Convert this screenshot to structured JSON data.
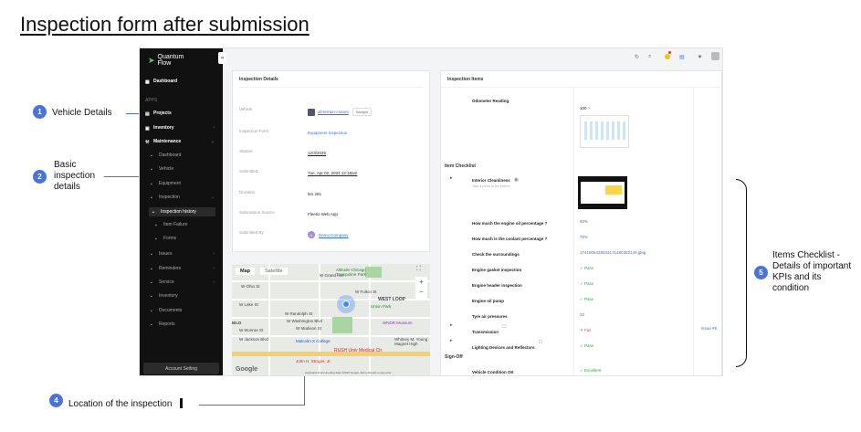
{
  "page_title": "Inspection form after submission",
  "callouts": [
    {
      "num": "1",
      "text": "Vehicle Details"
    },
    {
      "num": "2",
      "text": "Basic inspection details"
    },
    {
      "num": "4",
      "text": "Location of the inspection"
    },
    {
      "num": "5",
      "text": "Items Checklist - Details of important KPIs and its condition"
    }
  ],
  "sidebar": {
    "logo_line1": "Quantum",
    "logo_line2": "Flow",
    "dashboard": "Dashboard",
    "apps_heading": "APPS",
    "projects": "Projects",
    "inventory": "Inventory",
    "maintenance": "Maintenance",
    "sub_dashboard": "Dashboard",
    "vehicle": "Vehicle",
    "equipment": "Equipment",
    "inspection": "Inspection",
    "inspection_history": "Inspection history",
    "item_failure": "Item Failure",
    "forms": "Forms",
    "issues": "Issues",
    "reminders": "Reminders",
    "service": "Service",
    "inventory2": "Inventory",
    "documents": "Documents",
    "reports": "Reports",
    "account_setting": "Account Setting"
  },
  "details": {
    "title": "Inspection Details",
    "vehicle_label": "Vehicle",
    "vehicle_value": "all-terrain-cranes",
    "vehicle_chip": "Sample",
    "form_label": "Inspection Form",
    "form_value": "Equipment Inspection",
    "started_label": "Started",
    "started_value": "12/3/2025",
    "submitted_label": "Submitted",
    "submitted_value": "Tue, Apr 02, 2024 12:18am",
    "duration_label": "Duration",
    "duration_value": "5m 28s",
    "source_label": "Submission Source",
    "source_value": "Fleetio Web App",
    "by_label": "Submitted By",
    "by_avatar": "D",
    "by_value": "Demo Company"
  },
  "map": {
    "tab_map": "Map",
    "tab_satellite": "Satellite",
    "labels": [
      "W Grand Ave",
      "Altitude Chicago Trampoline Park",
      "W Ohio St",
      "W Lake St",
      "W Fulton St",
      "WEST LOOP",
      "Union Park",
      "W Randolph St",
      "W Washington Blvd",
      "W Madison St",
      "W Monroe St",
      "W Jackson Blvd",
      "WNDR Museum",
      "Malcolm X College",
      "Whitney M. Young Magnet High",
      "RUSH Univ Medical Ctr",
      "John H. Stroger, Jr.",
      "IELD"
    ],
    "google": "Google",
    "footer": "Keyboard shortcuts   Map data ©2024 Google   Terms   Report a map error"
  },
  "items": {
    "title": "Inspection Items",
    "odometer_label": "Odometer Reading",
    "odometer_value": "100",
    "checklist_heading": "Item Checklist",
    "interior_label": "Interior Cleanliness",
    "interior_hint": "Take a photo of the interior",
    "rows": [
      {
        "label": "How much the engine oil percentage ?",
        "value": "60%",
        "kind": "blue"
      },
      {
        "label": "How much is the coolant percentage ?",
        "value": "70%",
        "kind": "blue"
      },
      {
        "label": "Check the surroundings",
        "value": "1741805428033171480382149.jpeg",
        "kind": "blue"
      },
      {
        "label": "Engine gasket inspection",
        "value": "Pass",
        "kind": "pass"
      },
      {
        "label": "Engine header inspection",
        "value": "Pass",
        "kind": "pass"
      },
      {
        "label": "Engine oil pump",
        "value": "Pass",
        "kind": "pass"
      },
      {
        "label": "Tyre air pressures",
        "value": "22",
        "kind": "blue"
      },
      {
        "label": "Transmission",
        "value": "Fail",
        "kind": "fail"
      },
      {
        "label": "Lighting Devices and Reflectors",
        "value": "Pass",
        "kind": "pass"
      }
    ],
    "issue_link": "Issue #8",
    "signoff_heading": "Sign-Off",
    "vehicle_condition_label": "Vehicle Condition OK",
    "vehicle_condition_value": "Excellent"
  },
  "colors": {
    "accent": "#4a72d8",
    "pass": "#28a745",
    "fail": "#d9534f",
    "sidebar": "#111111"
  }
}
